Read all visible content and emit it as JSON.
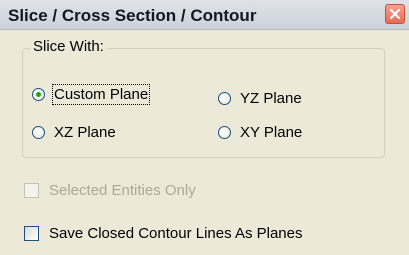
{
  "window": {
    "title": "Slice / Cross Section / Contour",
    "close_icon": "close-icon",
    "accent_close": "#e96a53"
  },
  "slice_group": {
    "legend": "Slice With:",
    "options": [
      {
        "label": "Custom Plane",
        "checked": true
      },
      {
        "label": "YZ Plane",
        "checked": false
      },
      {
        "label": "XZ Plane",
        "checked": false
      },
      {
        "label": "XY Plane",
        "checked": false
      }
    ]
  },
  "checkboxes": [
    {
      "label": "Selected Entities Only",
      "checked": false,
      "disabled": true
    },
    {
      "label": "Save Closed Contour Lines As Planes",
      "checked": false,
      "disabled": false
    }
  ]
}
